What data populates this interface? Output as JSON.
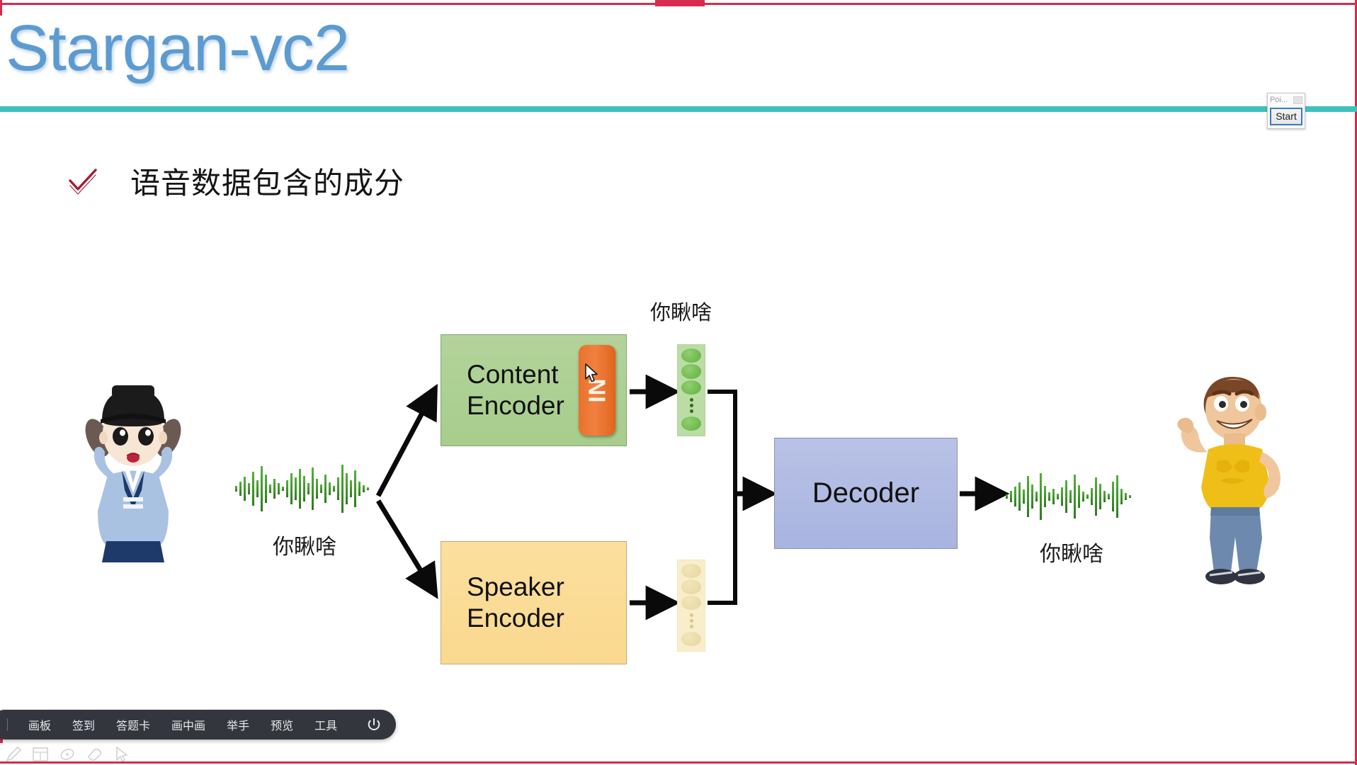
{
  "slide": {
    "title": "Stargan-vc2",
    "heading": "语音数据包含的成分",
    "title_color": "#5b9bd1",
    "rule_color": "#3ec1bd",
    "bullet_color": "#a51c33"
  },
  "diagram": {
    "content_encoder": {
      "label": "Content\nEncoder",
      "color": "#aed293"
    },
    "speaker_encoder": {
      "label": "Speaker\nEncoder",
      "color": "#fbdc96"
    },
    "decoder": {
      "label": "Decoder",
      "color": "#b0bbe3"
    },
    "norm_chip": {
      "label": "IN",
      "color": "#e8722c"
    },
    "content_latent_caption": "你瞅啥",
    "input_wave_caption": "你瞅啥",
    "output_wave_caption": "你瞅啥",
    "wave_color": "#3f9b2f",
    "latent_nodes_content": 4,
    "latent_nodes_speaker": 4,
    "source_speaker_name": "source-speaker-avatar",
    "target_speaker_name": "target-speaker-avatar"
  },
  "popup": {
    "title": "Poi...",
    "start_label": "Start"
  },
  "dock": {
    "items": [
      {
        "label": "画板",
        "name": "dock-item-whiteboard"
      },
      {
        "label": "签到",
        "name": "dock-item-signin"
      },
      {
        "label": "答题卡",
        "name": "dock-item-answer-card"
      },
      {
        "label": "画中画",
        "name": "dock-item-pip"
      },
      {
        "label": "举手",
        "name": "dock-item-raise-hand"
      },
      {
        "label": "预览",
        "name": "dock-item-preview"
      },
      {
        "label": "工具",
        "name": "dock-item-tools"
      }
    ],
    "power_icon": "power-icon"
  },
  "toolstrip": {
    "icons": [
      "pen-icon",
      "grid-icon",
      "mouse-icon",
      "eraser-icon",
      "pointer-icon"
    ]
  }
}
